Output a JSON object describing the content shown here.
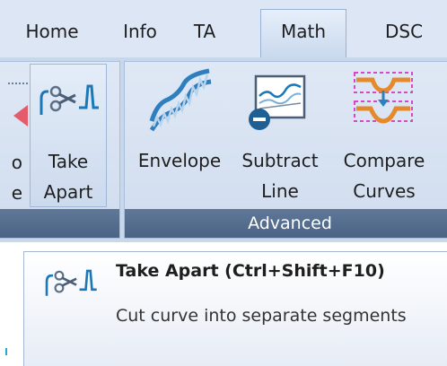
{
  "tabs": [
    "Home",
    "Info",
    "TA",
    "Math",
    "DSC"
  ],
  "active_tab": "Math",
  "ribbon": {
    "partial_button": {
      "line1": "o",
      "line2": "e"
    },
    "take_apart": {
      "line1": "Take",
      "line2": "Apart"
    },
    "advanced_group": {
      "label": "Advanced",
      "envelope": {
        "line1": "Envelope"
      },
      "subtract_line": {
        "line1": "Subtract",
        "line2": "Line"
      },
      "compare_curves": {
        "line1": "Compare",
        "line2": "Curves"
      }
    }
  },
  "tooltip": {
    "title": "Take Apart (Ctrl+Shift+F10)",
    "description": "Cut curve into separate segments"
  },
  "icons": {
    "take_apart": "scissors-curve-icon",
    "envelope": "envelope-curve-icon",
    "subtract_line": "subtract-line-icon",
    "compare_curves": "compare-curves-icon"
  },
  "colors": {
    "tab_bar": "#dce6f4",
    "ribbon_bg": "#c9d7eb",
    "group_label_bg": "#4b6485",
    "accent_blue": "#1b78b8",
    "compare_orange": "#e48a2c",
    "compare_magenta": "#d648c4"
  }
}
